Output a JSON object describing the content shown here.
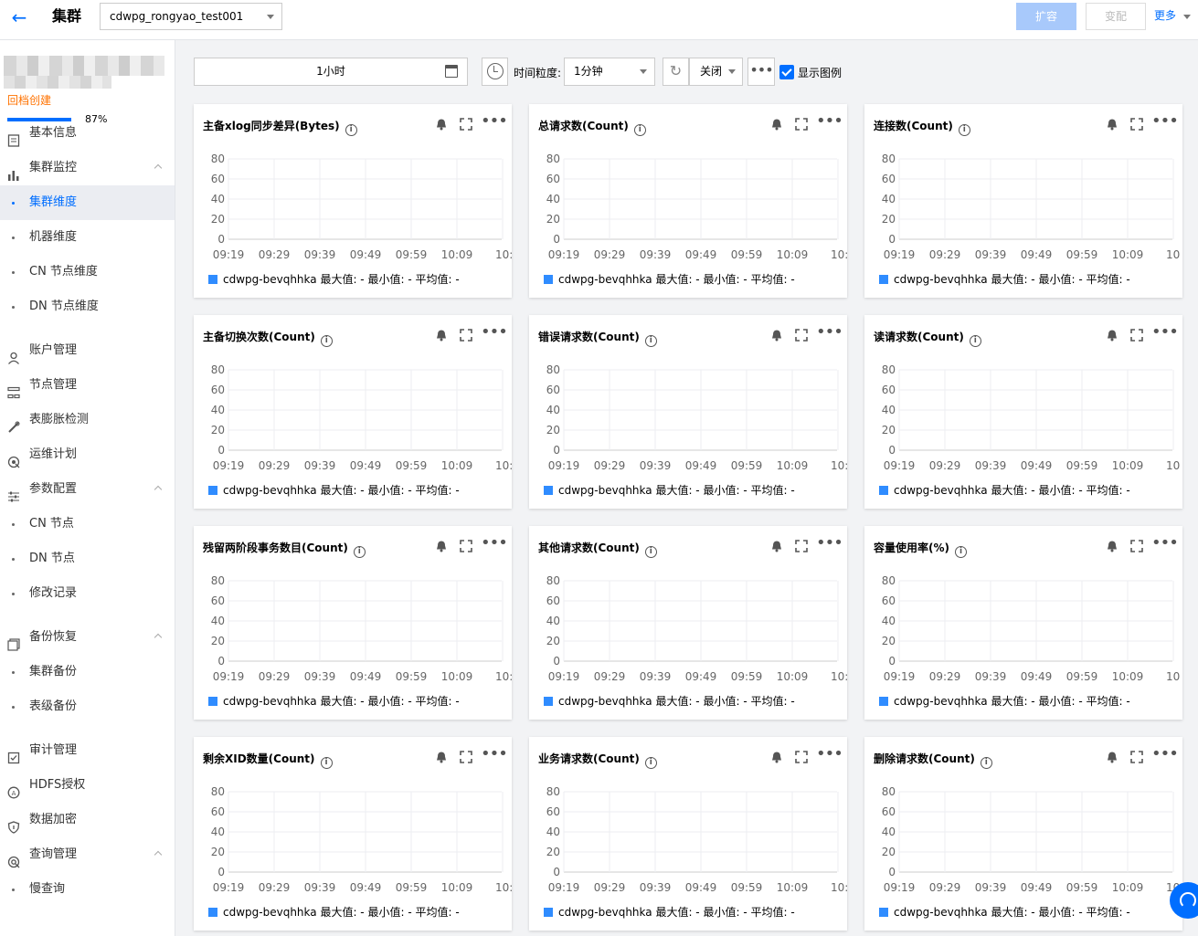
{
  "header": {
    "back_icon": "arrow-left-icon",
    "title": "集群",
    "cluster_selected": "cdwpg_rongyao_test001",
    "btn_expand": "扩容",
    "btn_change": "变配",
    "btn_more": "更多"
  },
  "sidebar": {
    "archive": "回档创建",
    "progress": 87,
    "progress_text": "87%",
    "items": [
      {
        "label": "基本信息",
        "icon": "document-icon",
        "type": "main"
      },
      {
        "label": "集群监控",
        "icon": "bar-chart-icon",
        "type": "main",
        "expanded": true
      },
      {
        "label": "集群维度",
        "type": "sub",
        "active": true
      },
      {
        "label": "机器维度",
        "type": "sub"
      },
      {
        "label": "CN 节点维度",
        "type": "sub"
      },
      {
        "label": "DN 节点维度",
        "type": "sub"
      },
      {
        "label": "账户管理",
        "icon": "user-icon",
        "type": "main"
      },
      {
        "label": "节点管理",
        "icon": "node-icon",
        "type": "main"
      },
      {
        "label": "表膨胀检测",
        "icon": "wrench-icon",
        "type": "main"
      },
      {
        "label": "运维计划",
        "icon": "plan-icon",
        "type": "main"
      },
      {
        "label": "参数配置",
        "icon": "sliders-icon",
        "type": "main",
        "expanded": true
      },
      {
        "label": "CN 节点",
        "type": "sub"
      },
      {
        "label": "DN 节点",
        "type": "sub"
      },
      {
        "label": "修改记录",
        "type": "sub"
      },
      {
        "label": "备份恢复",
        "icon": "backup-icon",
        "type": "main",
        "expanded": true
      },
      {
        "label": "集群备份",
        "type": "sub"
      },
      {
        "label": "表级备份",
        "type": "sub"
      },
      {
        "label": "审计管理",
        "icon": "audit-icon",
        "type": "main"
      },
      {
        "label": "HDFS授权",
        "icon": "hdfs-icon",
        "type": "main"
      },
      {
        "label": "数据加密",
        "icon": "shield-icon",
        "type": "main"
      },
      {
        "label": "查询管理",
        "icon": "query-icon",
        "type": "main",
        "expanded": true
      },
      {
        "label": "慢查询",
        "type": "sub"
      }
    ]
  },
  "toolbar": {
    "time_range": "1小时",
    "granularity_label": "时间粒度:",
    "granularity": "1分钟",
    "refresh_state": "关闭",
    "show_legend": "显示图例",
    "show_legend_checked": true
  },
  "chart_common": {
    "y_ticks": [
      "80",
      "60",
      "40",
      "20",
      "0"
    ],
    "x_ticks": [
      "09:19",
      "09:29",
      "09:39",
      "09:49",
      "09:59",
      "10:09",
      "10:"
    ],
    "ylim": [
      0,
      80
    ],
    "legend_name": "cdwpg-bevqhhka",
    "stats": "最大值: - 最小值: - 平均值: -",
    "accent": "#2f8cff"
  },
  "charts": [
    {
      "title": "主备xlog同步差异(Bytes)"
    },
    {
      "title": "总请求数(Count)"
    },
    {
      "title": "连接数(Count)"
    },
    {
      "title": "主备切换次数(Count)"
    },
    {
      "title": "错误请求数(Count)"
    },
    {
      "title": "读请求数(Count)"
    },
    {
      "title": "残留两阶段事务数目(Count)"
    },
    {
      "title": "其他请求数(Count)"
    },
    {
      "title": "容量使用率(%)"
    },
    {
      "title": "剩余XID数量(Count)"
    },
    {
      "title": "业务请求数(Count)"
    },
    {
      "title": "删除请求数(Count)"
    }
  ],
  "chart_data": [
    {
      "type": "line",
      "title": "主备xlog同步差异(Bytes)",
      "categories": [
        "09:19",
        "09:29",
        "09:39",
        "09:49",
        "09:59",
        "10:09",
        "10:"
      ],
      "series": [
        {
          "name": "cdwpg-bevqhhka",
          "values": []
        }
      ],
      "ylim": [
        0,
        80
      ],
      "grid": true,
      "legend": "bottom-left"
    },
    {
      "type": "line",
      "title": "总请求数(Count)",
      "categories": [
        "09:19",
        "09:29",
        "09:39",
        "09:49",
        "09:59",
        "10:09",
        "10:"
      ],
      "series": [
        {
          "name": "cdwpg-bevqhhka",
          "values": []
        }
      ],
      "ylim": [
        0,
        80
      ],
      "grid": true,
      "legend": "bottom-left"
    },
    {
      "type": "line",
      "title": "连接数(Count)",
      "categories": [
        "09:19",
        "09:29",
        "09:39",
        "09:49",
        "09:59",
        "10:09",
        "10"
      ],
      "series": [
        {
          "name": "cdwpg-bevqhhka",
          "values": []
        }
      ],
      "ylim": [
        0,
        80
      ],
      "grid": true,
      "legend": "bottom-left"
    },
    {
      "type": "line",
      "title": "主备切换次数(Count)",
      "categories": [
        "09:19",
        "09:29",
        "09:39",
        "09:49",
        "09:59",
        "10:09",
        "10:"
      ],
      "series": [
        {
          "name": "cdwpg-bevqhhka",
          "values": []
        }
      ],
      "ylim": [
        0,
        80
      ],
      "grid": true,
      "legend": "bottom-left"
    },
    {
      "type": "line",
      "title": "错误请求数(Count)",
      "categories": [
        "09:19",
        "09:29",
        "09:39",
        "09:49",
        "09:59",
        "10:09",
        "10:"
      ],
      "series": [
        {
          "name": "cdwpg-bevqhhka",
          "values": []
        }
      ],
      "ylim": [
        0,
        80
      ],
      "grid": true,
      "legend": "bottom-left"
    },
    {
      "type": "line",
      "title": "读请求数(Count)",
      "categories": [
        "09:19",
        "09:29",
        "09:39",
        "09:49",
        "09:59",
        "10:09",
        "10"
      ],
      "series": [
        {
          "name": "cdwpg-bevqhhka",
          "values": []
        }
      ],
      "ylim": [
        0,
        80
      ],
      "grid": true,
      "legend": "bottom-left"
    },
    {
      "type": "line",
      "title": "残留两阶段事务数目(Count)",
      "categories": [
        "09:19",
        "09:29",
        "09:39",
        "09:49",
        "09:59",
        "10:09",
        "10:"
      ],
      "series": [
        {
          "name": "cdwpg-bevqhhka",
          "values": []
        }
      ],
      "ylim": [
        0,
        80
      ],
      "grid": true,
      "legend": "bottom-left"
    },
    {
      "type": "line",
      "title": "其他请求数(Count)",
      "categories": [
        "09:19",
        "09:29",
        "09:39",
        "09:49",
        "09:59",
        "10:09",
        "10:"
      ],
      "series": [
        {
          "name": "cdwpg-bevqhhka",
          "values": []
        }
      ],
      "ylim": [
        0,
        80
      ],
      "grid": true,
      "legend": "bottom-left"
    },
    {
      "type": "line",
      "title": "容量使用率(%)",
      "categories": [
        "09:19",
        "09:29",
        "09:39",
        "09:49",
        "09:59",
        "10:09",
        "10"
      ],
      "series": [
        {
          "name": "cdwpg-bevqhhka",
          "values": []
        }
      ],
      "ylim": [
        0,
        80
      ],
      "grid": true,
      "legend": "bottom-left"
    },
    {
      "type": "line",
      "title": "剩余XID数量(Count)",
      "categories": [
        "09:19",
        "09:29",
        "09:39",
        "09:49",
        "09:59",
        "10:09",
        "10:"
      ],
      "series": [
        {
          "name": "cdwpg-bevqhhka",
          "values": []
        }
      ],
      "ylim": [
        0,
        80
      ],
      "grid": true,
      "legend": "bottom-left"
    },
    {
      "type": "line",
      "title": "业务请求数(Count)",
      "categories": [
        "09:19",
        "09:29",
        "09:39",
        "09:49",
        "09:59",
        "10:09",
        "10:"
      ],
      "series": [
        {
          "name": "cdwpg-bevqhhka",
          "values": []
        }
      ],
      "ylim": [
        0,
        80
      ],
      "grid": true,
      "legend": "bottom-left"
    },
    {
      "type": "line",
      "title": "删除请求数(Count)",
      "categories": [
        "09:19",
        "09:29",
        "09:39",
        "09:49",
        "09:59",
        "10:09",
        "10"
      ],
      "series": [
        {
          "name": "cdwpg-bevqhhka",
          "values": []
        }
      ],
      "ylim": [
        0,
        80
      ],
      "grid": true,
      "legend": "bottom-left"
    }
  ]
}
